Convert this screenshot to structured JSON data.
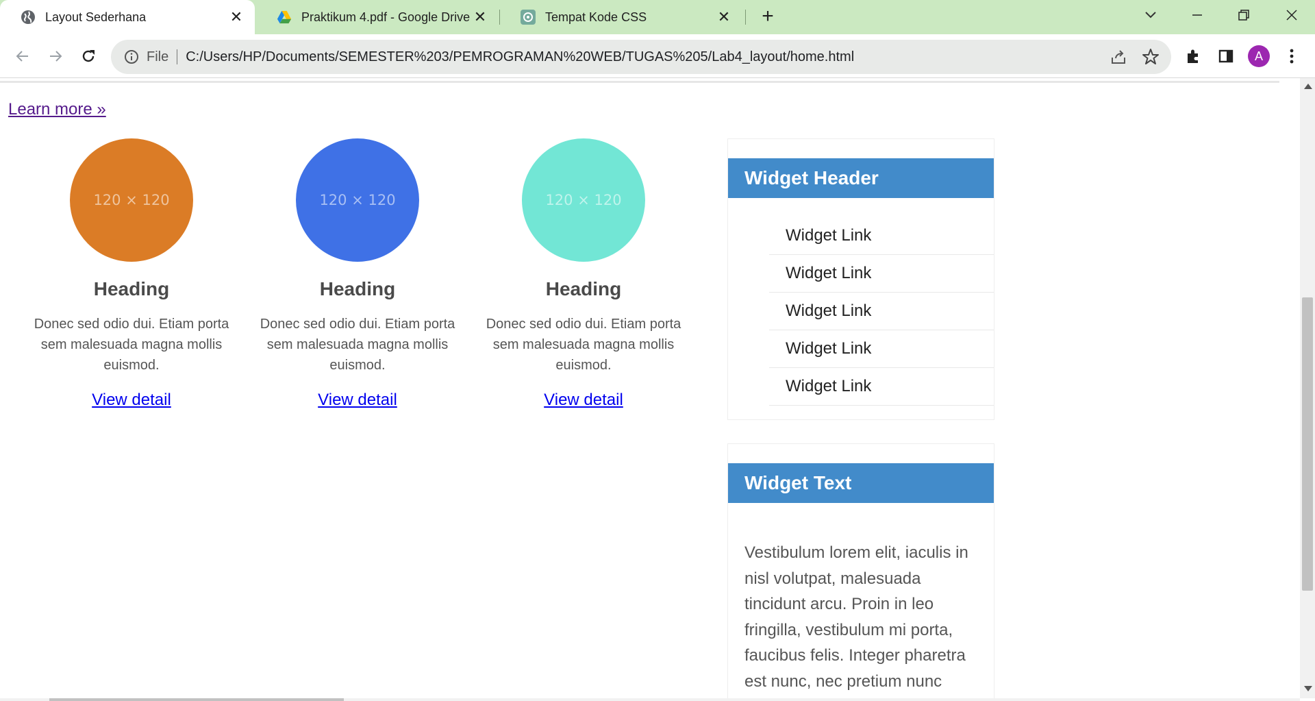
{
  "browser": {
    "tabs": [
      {
        "title": "Layout Sederhana",
        "icon": "globe-icon",
        "active": true
      },
      {
        "title": "Praktikum 4.pdf - Google Drive",
        "icon": "google-drive-icon",
        "active": false
      },
      {
        "title": "Tempat Kode CSS",
        "icon": "chatgpt-icon",
        "active": false
      }
    ],
    "new_tab": "+",
    "omnibox": {
      "file_label": "File",
      "url": "C:/Users/HP/Documents/SEMESTER%203/PEMROGRAMAN%20WEB/TUGAS%205/Lab4_layout/home.html"
    },
    "avatar_initial": "A",
    "colors": {
      "tabstrip": "#cbe9c1",
      "avatar": "#9c27b0"
    }
  },
  "page": {
    "learn_more": "Learn more »",
    "features": [
      {
        "placeholder": "120 × 120",
        "color": "#db7c26",
        "heading": "Heading",
        "text": "Donec sed odio dui. Etiam porta sem malesuada magna mollis euismod.",
        "link": "View detail"
      },
      {
        "placeholder": "120 × 120",
        "color": "#3f71e6",
        "heading": "Heading",
        "text": "Donec sed odio dui. Etiam porta sem malesuada magna mollis euismod.",
        "link": "View detail"
      },
      {
        "placeholder": "120 × 120",
        "color": "#72e6d5",
        "heading": "Heading",
        "text": "Donec sed odio dui. Etiam porta sem malesuada magna mollis euismod.",
        "link": "View detail"
      }
    ],
    "widget_links": {
      "header": "Widget Header",
      "links": [
        "Widget Link",
        "Widget Link",
        "Widget Link",
        "Widget Link",
        "Widget Link"
      ]
    },
    "widget_text": {
      "header": "Widget Text",
      "body": "Vestibulum lorem elit, iaculis in nisl volutpat, malesuada tincidunt arcu. Proin in leo fringilla, vestibulum mi porta, faucibus felis. Integer pharetra est nunc, nec pretium nunc"
    },
    "colors": {
      "widget_header": "#428bca",
      "link": "#0000ee",
      "visited_link": "#551a8b"
    }
  }
}
